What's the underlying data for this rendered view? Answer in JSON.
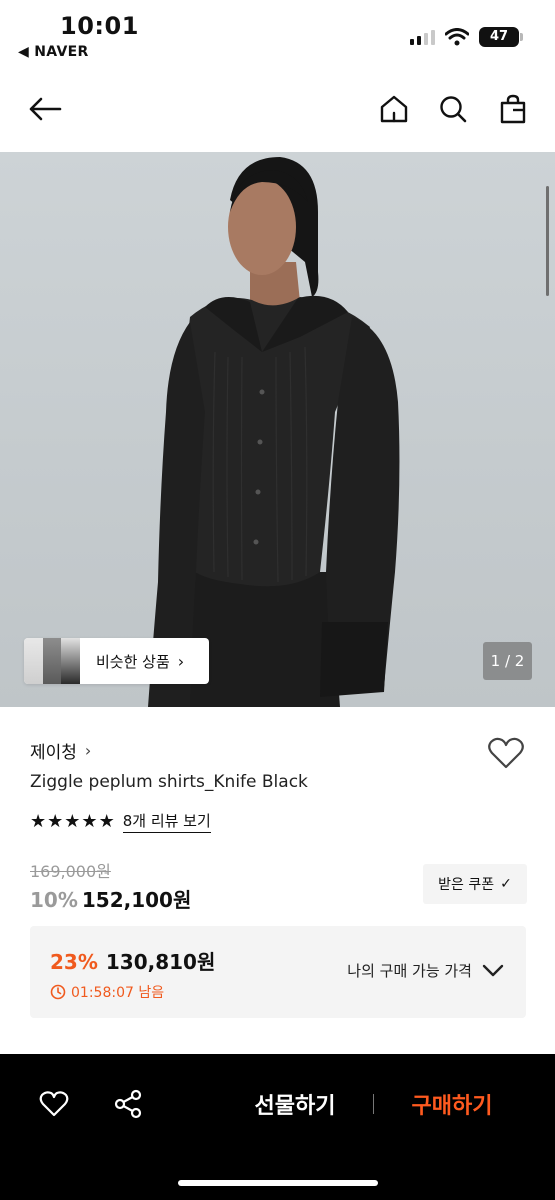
{
  "status_bar": {
    "time": "10:01",
    "back_app": "◀ NAVER",
    "battery": "47"
  },
  "nav": {
    "icons": [
      "back-arrow-icon",
      "home-icon",
      "search-icon",
      "shopping-bag-icon"
    ]
  },
  "hero": {
    "similar_products_label": "비슷한 상품",
    "similar_chevron": "›",
    "page_indicator": "1 / 2"
  },
  "product": {
    "brand": "제이청",
    "brand_chevron": "›",
    "name": "Ziggle peplum shirts_Knife Black",
    "stars": [
      "★",
      "★",
      "★",
      "★",
      "★"
    ],
    "review_link": "8개 리뷰 보기",
    "original_price": "169,000원",
    "discount": "10%",
    "sale_price": "152,100원",
    "coupon_label": "받은 쿠폰",
    "coupon_chevron": "✓"
  },
  "best_price": {
    "discount": "23%",
    "price": "130,810원",
    "timer": "01:58:07 남음",
    "my_price_label": "나의 구매 가능 가격"
  },
  "bottom_bar": {
    "gift_label": "선물하기",
    "buy_label": "구매하기"
  },
  "colors": {
    "accent": "#f05a1e",
    "buy": "#ff5a1f",
    "bar": "#000000"
  }
}
